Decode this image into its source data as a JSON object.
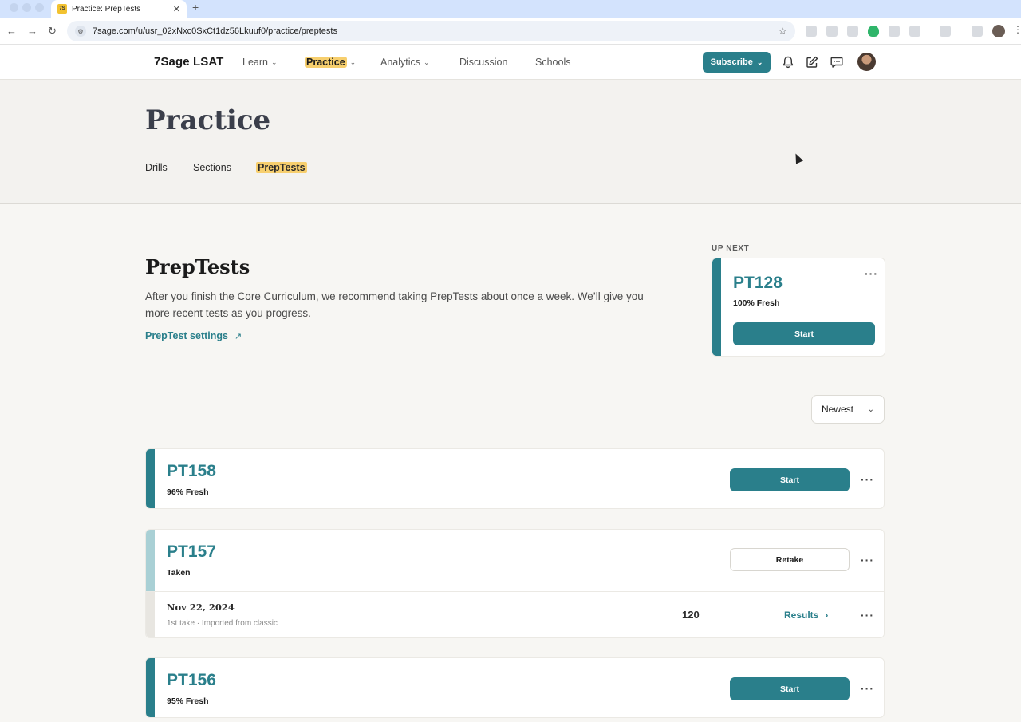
{
  "browser": {
    "tab_favicon": "7S",
    "tab_title": "Practice: PrepTests",
    "tab_close": "✕",
    "new_tab": "+",
    "url": "7sage.com/u/usr_02xNxc0SxCt1dz56Lkuuf0/practice/preptests"
  },
  "nav": {
    "logo": "7Sage LSAT",
    "items": [
      {
        "label": "Learn",
        "dropdown": true
      },
      {
        "label": "Practice",
        "dropdown": true,
        "active": true
      },
      {
        "label": "Analytics",
        "dropdown": true
      },
      {
        "label": "Discussion",
        "dropdown": false
      },
      {
        "label": "Schools",
        "dropdown": false
      }
    ],
    "subscribe_label": "Subscribe"
  },
  "hero": {
    "title": "Practice",
    "tabs": [
      "Drills",
      "Sections",
      "PrepTests"
    ],
    "active_tab": "PrepTests"
  },
  "preptests": {
    "title": "PrepTests",
    "description": "After you finish the Core Curriculum, we recommend taking PrepTests about once a week. We’ll give you more recent tests as you progress.",
    "settings_link": "PrepTest settings",
    "settings_arrow": "↗"
  },
  "up_next": {
    "label": "UP NEXT",
    "name": "PT128",
    "status": "100% Fresh",
    "button": "Start"
  },
  "sort": {
    "selected": "Newest"
  },
  "tests": [
    {
      "name": "PT158",
      "status": "96% Fresh",
      "button": "Start"
    },
    {
      "name": "PT157",
      "status": "Taken",
      "button": "Retake",
      "take": {
        "date": "Nov 22, 2024",
        "meta": "1st take · Imported from classic",
        "score": "120",
        "results_label": "Results"
      }
    },
    {
      "name": "PT156",
      "status": "95% Fresh",
      "button": "Start"
    }
  ],
  "colors": {
    "teal": "#2a7f8b",
    "highlight": "#f7cf6e",
    "background": "#f7f6f3"
  }
}
